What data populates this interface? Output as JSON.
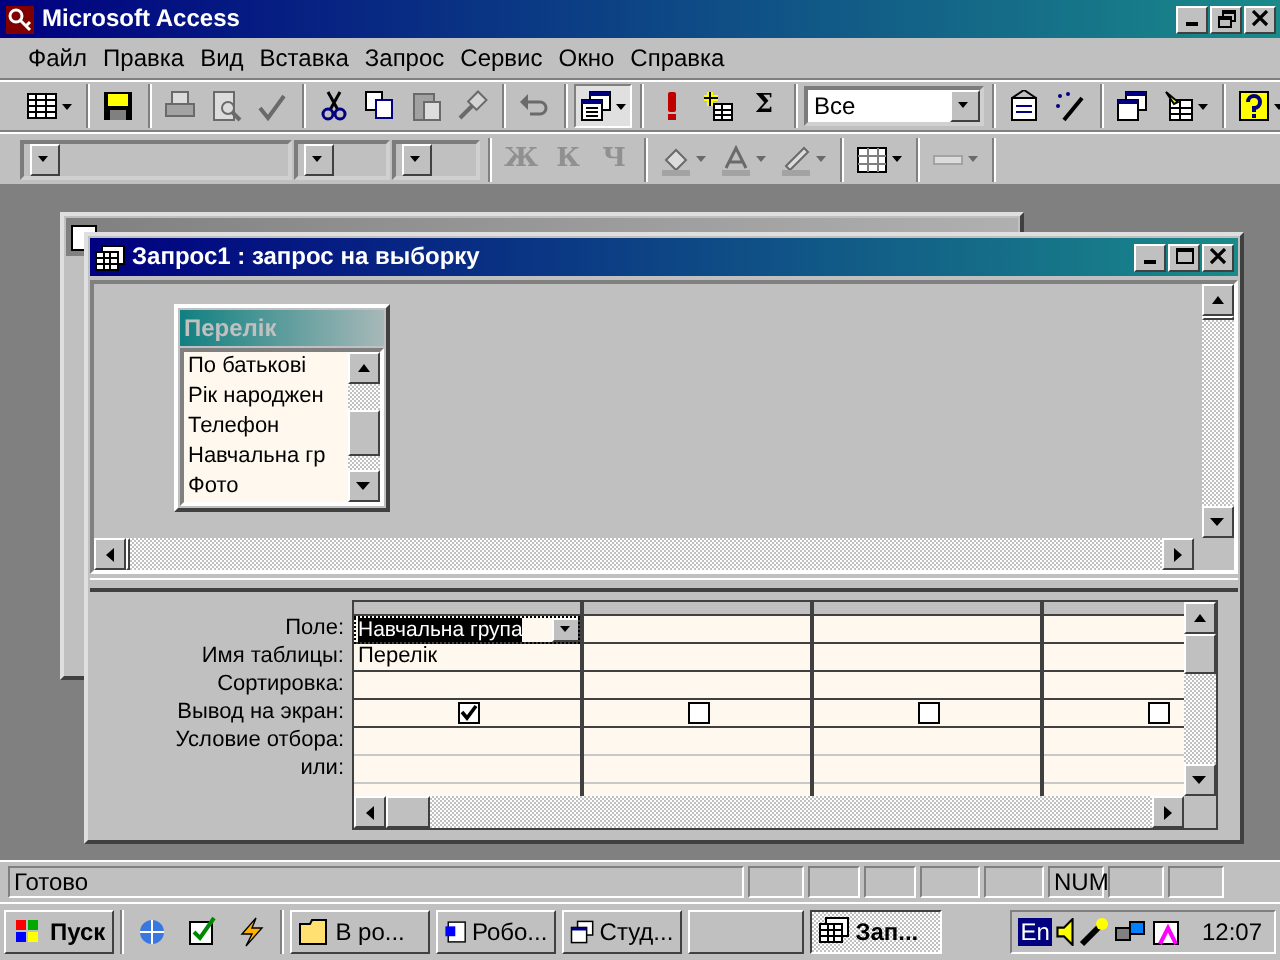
{
  "app": {
    "title": "Microsoft Access"
  },
  "menu": [
    "Файл",
    "Правка",
    "Вид",
    "Вставка",
    "Запрос",
    "Сервис",
    "Окно",
    "Справка"
  ],
  "toolbar1": [
    [
      {
        "kind": "button",
        "dropdown": true,
        "disabled": false
      }
    ],
    [
      {
        "kind": "button",
        "disabled": false
      }
    ],
    [
      {
        "kind": "button",
        "disabled": true
      },
      {
        "kind": "button",
        "disabled": true
      },
      {
        "kind": "button",
        "disabled": true
      }
    ],
    [
      {
        "kind": "button",
        "disabled": false
      },
      {
        "kind": "button",
        "disabled": false
      },
      {
        "kind": "button",
        "disabled": true
      },
      {
        "kind": "button",
        "disabled": true
      }
    ],
    [
      {
        "kind": "button",
        "disabled": true
      }
    ],
    [
      {
        "kind": "button",
        "dropdown": true,
        "disabled": false
      }
    ],
    [
      {
        "kind": "button",
        "disabled": false
      },
      {
        "kind": "button",
        "disabled": false
      },
      {
        "kind": "text-button",
        "label": "Σ",
        "disabled": false
      }
    ],
    [
      {
        "kind": "combo",
        "value": "Все"
      }
    ],
    [
      {
        "kind": "button",
        "disabled": false
      },
      {
        "kind": "button",
        "disabled": false
      }
    ],
    [
      {
        "kind": "button",
        "disabled": false
      },
      {
        "kind": "button",
        "dropdown": true,
        "disabled": false
      }
    ],
    [
      {
        "kind": "button",
        "dropdown": true,
        "disabled": false
      }
    ]
  ],
  "toolbar2": [
    [
      {
        "kind": "combo"
      },
      {
        "kind": "combo"
      },
      {
        "kind": "combo"
      }
    ],
    [
      {
        "kind": "text-button",
        "label": "Ж",
        "disabled": true
      },
      {
        "kind": "text-button",
        "label": "К",
        "disabled": true
      },
      {
        "kind": "text-button",
        "label": "Ч",
        "disabled": true
      }
    ],
    [
      {
        "kind": "button",
        "dropdown": true,
        "disabled": true
      },
      {
        "kind": "button",
        "dropdown": true,
        "disabled": true
      },
      {
        "kind": "button",
        "dropdown": true,
        "disabled": true
      }
    ],
    [
      {
        "kind": "button",
        "dropdown": true,
        "disabled": false
      }
    ],
    [
      {
        "kind": "button",
        "dropdown": true,
        "disabled": true
      }
    ]
  ],
  "query_window": {
    "title": "Запрос1 : запрос на выборку",
    "table": {
      "title": "Перелік",
      "fields": [
        "По батькові",
        "Рік народжен",
        "Телефон",
        "Навчальна гр",
        "Фото"
      ]
    },
    "row_labels": [
      "Поле:",
      "Имя таблицы:",
      "Сортировка:",
      "Вывод на экран:",
      "Условие отбора:",
      "или:"
    ],
    "columns": [
      {
        "field": "Навчальна група",
        "table": "Перелік",
        "show": true,
        "selected": true
      },
      {
        "show": false,
        "selected": false
      },
      {
        "show": false,
        "selected": false
      },
      {
        "show": false,
        "selected": false
      }
    ]
  },
  "status_bar": {
    "text": "Готово",
    "indicator": "NUM"
  },
  "taskbar": {
    "start": "Пуск",
    "tasks": [
      {
        "label": "В ро...",
        "selected": false
      },
      {
        "label": "Робо...",
        "selected": false
      },
      {
        "label": "Студ...",
        "selected": false
      },
      {
        "selected": false
      },
      {
        "label": "Зап...",
        "selected": true
      }
    ],
    "language": "En",
    "clock": "12:07"
  }
}
